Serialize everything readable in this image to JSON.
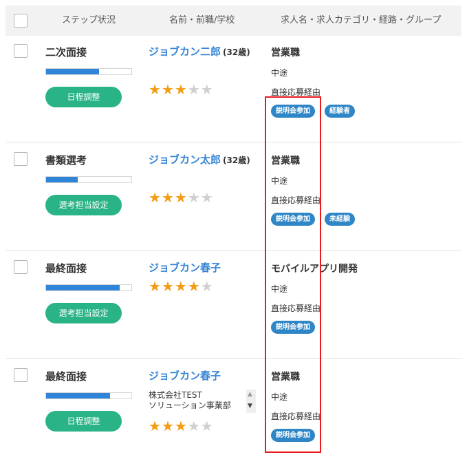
{
  "header": {
    "step_col": "ステップ状況",
    "name_col": "名前・前職/学校",
    "job_col": "求人名・求人カテゴリ・経路・グループ"
  },
  "rows": [
    {
      "step": "二次面接",
      "progress_pct": 62,
      "action": "日程調整",
      "name": "ジョブカン二郎",
      "age": "(32歳)",
      "rating": 3,
      "rating_max": 5,
      "job": "営業職",
      "category": "中途",
      "route": "直接応募経由",
      "tags": [
        "説明会参加",
        "経験者"
      ]
    },
    {
      "step": "書類選考",
      "progress_pct": 37,
      "action": "選考担当設定",
      "name": "ジョブカン太郎",
      "age": "(32歳)",
      "rating": 3,
      "rating_max": 5,
      "job": "営業職",
      "category": "中途",
      "route": "直接応募経由",
      "tags": [
        "説明会参加",
        "未経験"
      ]
    },
    {
      "step": "最終面接",
      "progress_pct": 86,
      "action": "選考担当設定",
      "name": "ジョブカン春子",
      "age": "",
      "rating": 4,
      "rating_max": 5,
      "job": "モバイルアプリ開発",
      "category": "中途",
      "route": "直接応募経由",
      "tags": [
        "説明会参加"
      ]
    },
    {
      "step": "最終面接",
      "progress_pct": 75,
      "action": "日程調整",
      "name": "ジョブカン春子",
      "age": "",
      "org_line1": "株式会社TEST",
      "org_line2": "ソリューション事業部",
      "rating": 3,
      "rating_max": 5,
      "job": "営業職",
      "category": "中途",
      "route": "直接応募経由",
      "tags": [
        "説明会参加"
      ]
    }
  ],
  "colors": {
    "name_link": "#3585d5",
    "progress": "#2f86d9",
    "action_button": "#2ab386",
    "tag": "#2f86c6",
    "star_on": "#f39c12",
    "star_off": "#cfcfcf",
    "highlight_box": "#ea1a1a"
  },
  "icons": {
    "star": "★",
    "scroll_up": "▲",
    "scroll_down": "▼"
  }
}
